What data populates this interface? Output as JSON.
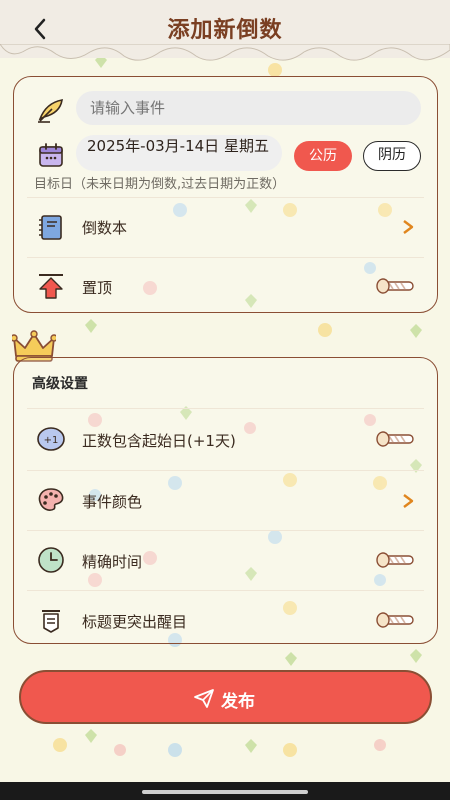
{
  "header": {
    "title": "添加新倒数",
    "back_icon": "chevron-left-icon"
  },
  "event": {
    "placeholder": "请输入事件",
    "date_text": "2025年-03月-14日 星期五",
    "calendar_solar": "公历",
    "calendar_lunar": "阴历",
    "hint": "目标日（未来日期为倒数,过去日期为正数）",
    "book_label": "倒数本",
    "pin_label": "置顶"
  },
  "advanced": {
    "title": "高级设置",
    "items": [
      {
        "label": "正数包含起始日(+1天)",
        "icon": "plus-one-icon",
        "control": "toggle"
      },
      {
        "label": "事件颜色",
        "icon": "palette-icon",
        "control": "chevron"
      },
      {
        "label": "精确时间",
        "icon": "clock-icon",
        "control": "toggle"
      },
      {
        "label": "标题更突出醒目",
        "icon": "title-icon",
        "control": "toggle"
      }
    ]
  },
  "publish": {
    "label": "发布",
    "icon": "paper-plane-icon"
  },
  "colors": {
    "accent": "#f0584e",
    "border": "#8a4e34",
    "background": "#f8f7e6"
  }
}
